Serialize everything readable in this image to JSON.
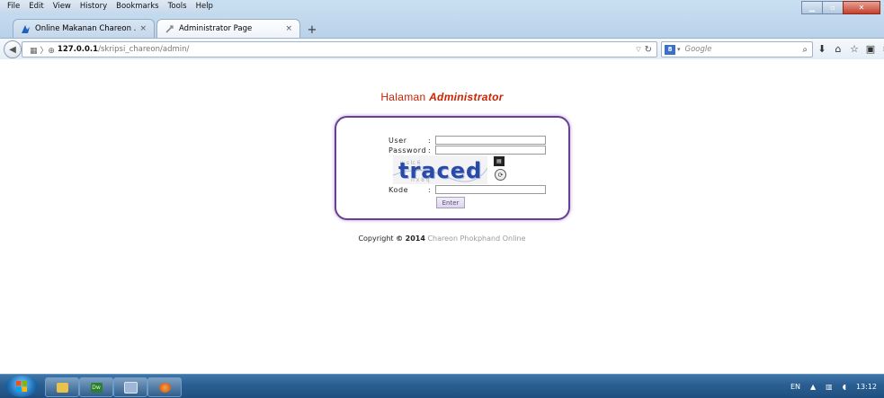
{
  "menubar": {
    "items": [
      "File",
      "Edit",
      "View",
      "History",
      "Bookmarks",
      "Tools",
      "Help"
    ]
  },
  "tabs": [
    {
      "label": "Online Makanan Chareon ...",
      "close": "×",
      "icon": "chareon-favicon-icon",
      "active": false
    },
    {
      "label": "Administrator Page",
      "close": "×",
      "icon": "admin-favicon-icon",
      "active": true
    }
  ],
  "newtab": {
    "label": "+"
  },
  "navbar": {
    "url_host": "127.0.0.1",
    "url_path": "/skripsi_chareon/admin/",
    "search_engine": "8",
    "search_placeholder": "Google"
  },
  "page": {
    "title_prefix": "Halaman",
    "title_emph": "Administrator",
    "title_color": "#cc2200",
    "box_border_color": "#6b3e96",
    "form": {
      "user_label": "User",
      "password_label": "Password",
      "kode_label": "Kode",
      "separator": ":",
      "captcha_text": "traced",
      "submit_label": "Enter"
    },
    "copyright": {
      "prefix": "Copyright",
      "symbol": "©",
      "year": "2014",
      "org": "Chareon Phokphand Online"
    }
  },
  "taskbar": {
    "apps": [
      "file-explorer-icon",
      "dreamweaver-icon",
      "window-icon",
      "firefox-icon"
    ],
    "dreamweaver_label": "Dw",
    "lang": "EN",
    "clock": "13:12"
  }
}
